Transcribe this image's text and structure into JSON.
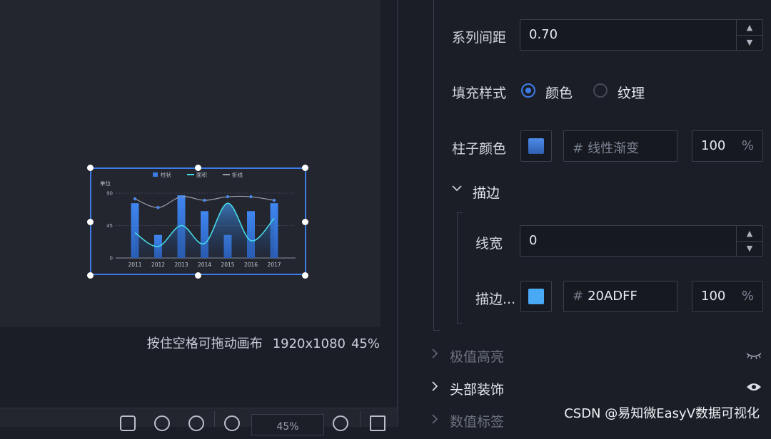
{
  "canvas": {
    "hint": "按住空格可拖动画布",
    "resolution": "1920x1080",
    "zoom": "45%",
    "zoom_field": "45%",
    "accent": "#3d7be6"
  },
  "chart_data": {
    "type": "bar",
    "legend": [
      "柱状",
      "面积",
      "折线"
    ],
    "ylabel": "单位",
    "yticks": [
      0,
      45,
      90
    ],
    "ylim": [
      0,
      90
    ],
    "categories": [
      "2011",
      "2012",
      "2013",
      "2014",
      "2015",
      "2016",
      "2017"
    ],
    "series": [
      {
        "name": "柱状",
        "type": "bar",
        "values": [
          76,
          32,
          87,
          65,
          32,
          65,
          76
        ],
        "color": "#3a7de8"
      },
      {
        "name": "面积",
        "type": "area",
        "values": [
          35,
          16,
          45,
          20,
          76,
          24,
          55
        ],
        "color": "#46d9e6"
      },
      {
        "name": "折线",
        "type": "line",
        "values": [
          82,
          70,
          85,
          80,
          85,
          85,
          80
        ],
        "color": "#9aa0aa"
      }
    ]
  },
  "panel": {
    "series_spacing": {
      "label": "系列间距",
      "value": "0.70"
    },
    "fill_style": {
      "label": "填充样式",
      "options": [
        "颜色",
        "纹理"
      ],
      "selected": "颜色"
    },
    "bar_color": {
      "label": "柱子颜色",
      "hex": "线性渐变",
      "opacity": "100",
      "unit": "%",
      "swatch": "#3f7ad7"
    },
    "stroke": {
      "title": "描边",
      "line_width": {
        "label": "线宽",
        "value": "0"
      },
      "stroke_color": {
        "label": "描边...",
        "hex": "20ADFF",
        "opacity": "100",
        "unit": "%",
        "swatch": "#4aa9f5"
      }
    },
    "sections": [
      {
        "title": "极值高亮",
        "visible": false
      },
      {
        "title": "头部装饰",
        "visible": true
      },
      {
        "title": "数值标签",
        "visible": false
      }
    ],
    "hash": "#"
  },
  "watermark": "CSDN @易知微EasyV数据可视化"
}
